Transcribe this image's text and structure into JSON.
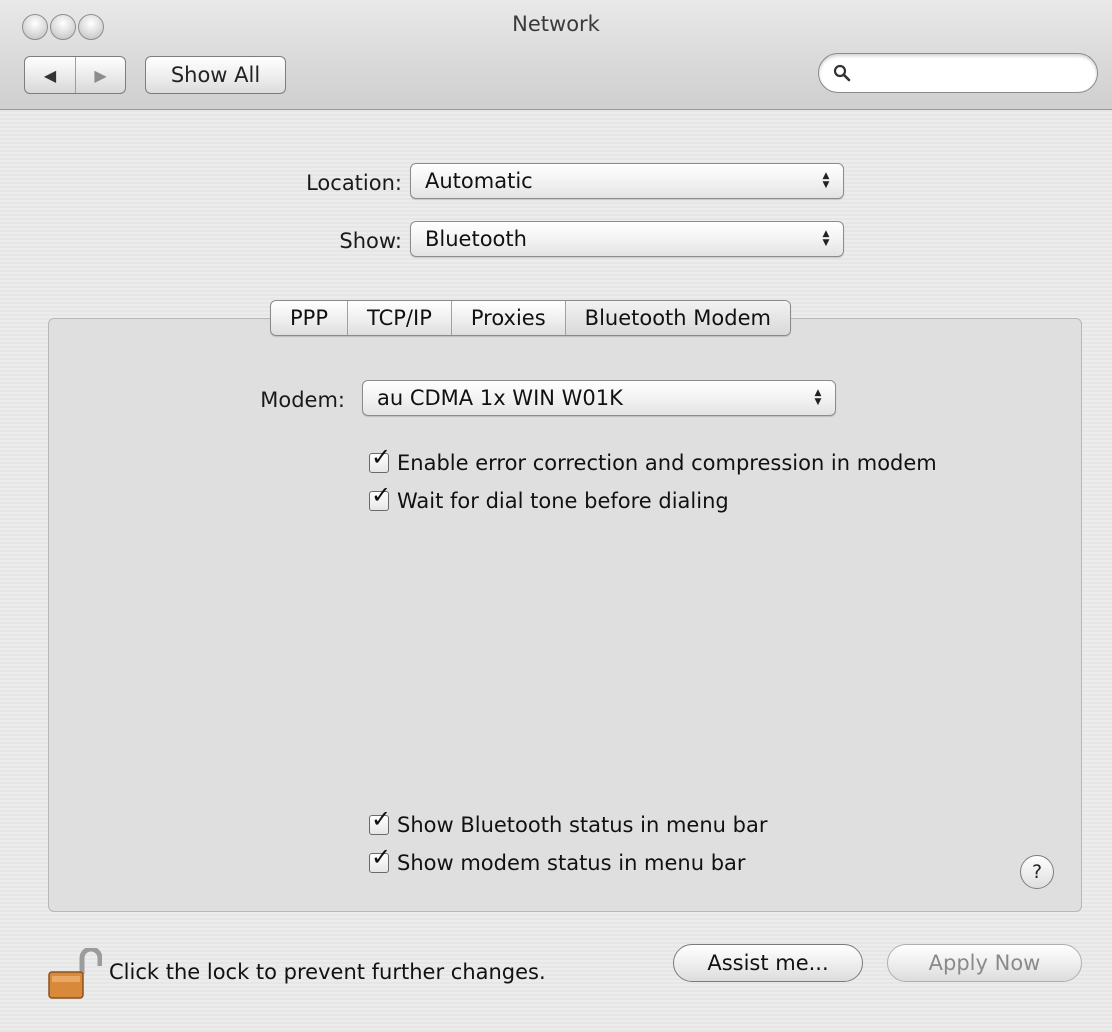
{
  "window": {
    "title": "Network"
  },
  "toolbar": {
    "back_glyph": "◀",
    "forward_glyph": "▶",
    "show_all_label": "Show All",
    "search_value": "",
    "search_placeholder": ""
  },
  "location": {
    "label": "Location:",
    "value": "Automatic"
  },
  "show": {
    "label": "Show:",
    "value": "Bluetooth"
  },
  "tabs": [
    {
      "label": "PPP",
      "selected": false
    },
    {
      "label": "TCP/IP",
      "selected": false
    },
    {
      "label": "Proxies",
      "selected": false
    },
    {
      "label": "Bluetooth Modem",
      "selected": true
    }
  ],
  "modem": {
    "label": "Modem:",
    "value": "au CDMA 1x WIN W01K",
    "options": [
      {
        "label": "Enable error correction and compression in modem",
        "checked": true
      },
      {
        "label": "Wait for dial tone before dialing",
        "checked": true
      }
    ],
    "status_options": [
      {
        "label": "Show Bluetooth status in menu bar",
        "checked": true
      },
      {
        "label": "Show modem status in menu bar",
        "checked": true
      }
    ],
    "help_glyph": "?"
  },
  "footer": {
    "lock_text": "Click the lock to prevent further changes.",
    "assist_label": "Assist me...",
    "apply_label": "Apply Now",
    "apply_enabled": false
  },
  "colors": {
    "lock_body": "#d8893a",
    "lock_shackle": "#9c9c9c"
  }
}
